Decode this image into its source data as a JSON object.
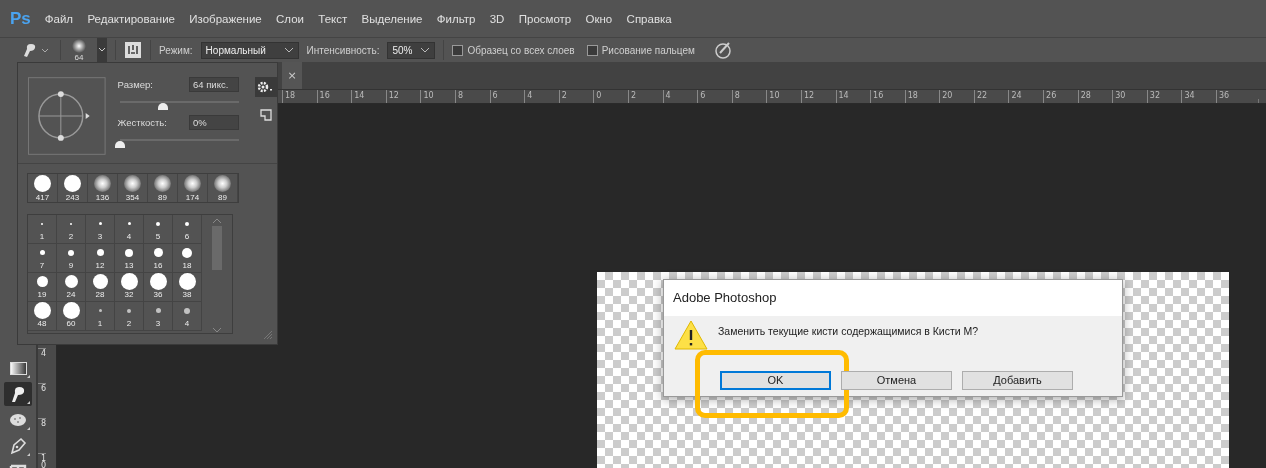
{
  "menu": {
    "logo": "Ps",
    "items": [
      "Файл",
      "Редактирование",
      "Изображение",
      "Слои",
      "Текст",
      "Выделение",
      "Фильтр",
      "3D",
      "Просмотр",
      "Окно",
      "Справка"
    ]
  },
  "options": {
    "brush_size": "64",
    "mode_label": "Режим:",
    "mode_value": "Нормальный",
    "intensity_label": "Интенсивность:",
    "intensity_value": "50%",
    "checkboxes": [
      {
        "label": "Образец со всех слоев",
        "checked": false
      },
      {
        "label": "Рисование пальцем",
        "checked": false
      }
    ]
  },
  "document_tab": {
    "close": "×"
  },
  "rulers": {
    "horizontal": [
      "18",
      "16",
      "14",
      "12",
      "10",
      "8",
      "6",
      "4",
      "2",
      "0",
      "2",
      "4",
      "6",
      "8",
      "10",
      "12",
      "14",
      "16",
      "18",
      "20",
      "22",
      "24",
      "26",
      "28",
      "30",
      "32",
      "34",
      "36"
    ],
    "vertical": [
      "4",
      "6",
      "8",
      "1 0"
    ]
  },
  "tools": [
    {
      "kind": "gradient",
      "selected": false
    },
    {
      "kind": "smudge",
      "selected": true
    },
    {
      "kind": "sponge",
      "selected": false
    },
    {
      "kind": "pen",
      "selected": false
    },
    {
      "kind": "type",
      "selected": false
    }
  ],
  "brush_panel": {
    "size_label": "Размер:",
    "size_value": "64 пикс.",
    "size_slider": {
      "level": 0.36
    },
    "hardness_label": "Жесткость:",
    "hardness_value": "0%",
    "hardness_slider": {
      "level": 0
    },
    "recent": [
      {
        "size": "417",
        "kind": "hard"
      },
      {
        "size": "243",
        "kind": "hard"
      },
      {
        "size": "136",
        "kind": "soft"
      },
      {
        "size": "354",
        "kind": "soft"
      },
      {
        "size": "89",
        "kind": "soft"
      },
      {
        "size": "174",
        "kind": "soft"
      },
      {
        "size": "89",
        "kind": "soft"
      }
    ],
    "presets": [
      {
        "size": "1",
        "kind": "hard"
      },
      {
        "size": "2",
        "kind": "hard"
      },
      {
        "size": "3",
        "kind": "hard"
      },
      {
        "size": "4",
        "kind": "hard"
      },
      {
        "size": "5",
        "kind": "hard"
      },
      {
        "size": "6",
        "kind": "hard"
      },
      {
        "size": "7",
        "kind": "hard"
      },
      {
        "size": "9",
        "kind": "hard"
      },
      {
        "size": "12",
        "kind": "hard"
      },
      {
        "size": "13",
        "kind": "hard"
      },
      {
        "size": "16",
        "kind": "hard"
      },
      {
        "size": "18",
        "kind": "hard"
      },
      {
        "size": "19",
        "kind": "hard"
      },
      {
        "size": "24",
        "kind": "hard"
      },
      {
        "size": "28",
        "kind": "hard"
      },
      {
        "size": "32",
        "kind": "hard"
      },
      {
        "size": "36",
        "kind": "hard"
      },
      {
        "size": "38",
        "kind": "hard"
      },
      {
        "size": "48",
        "kind": "hard"
      },
      {
        "size": "60",
        "kind": "hard"
      },
      {
        "size": "1",
        "kind": "soft"
      },
      {
        "size": "2",
        "kind": "soft"
      },
      {
        "size": "3",
        "kind": "soft"
      },
      {
        "size": "4",
        "kind": "soft"
      }
    ]
  },
  "dialog": {
    "title": "Adobe Photoshop",
    "message": "Заменить текущие кисти содержащимися в Кисти M?",
    "buttons": [
      {
        "label": "OK",
        "selected": true,
        "highlighted": true
      },
      {
        "label": "Отмена",
        "selected": false,
        "highlighted": false
      },
      {
        "label": "Добавить",
        "selected": false,
        "highlighted": false
      }
    ]
  }
}
